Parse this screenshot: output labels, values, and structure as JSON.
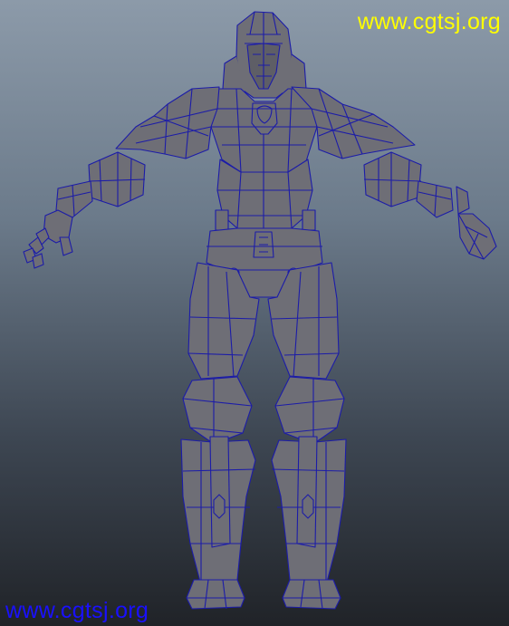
{
  "viewport": {
    "background_top": "#8c9aa9",
    "background_bottom": "#202328"
  },
  "model": {
    "mesh_color": "#6e6e76",
    "wire_color": "#1c1ca8"
  },
  "watermark": {
    "top_text": "www.cgtsj.org",
    "bottom_text": "www.cgtsj.org",
    "top_color": "#ffff00",
    "bottom_color": "#1a10ff"
  }
}
